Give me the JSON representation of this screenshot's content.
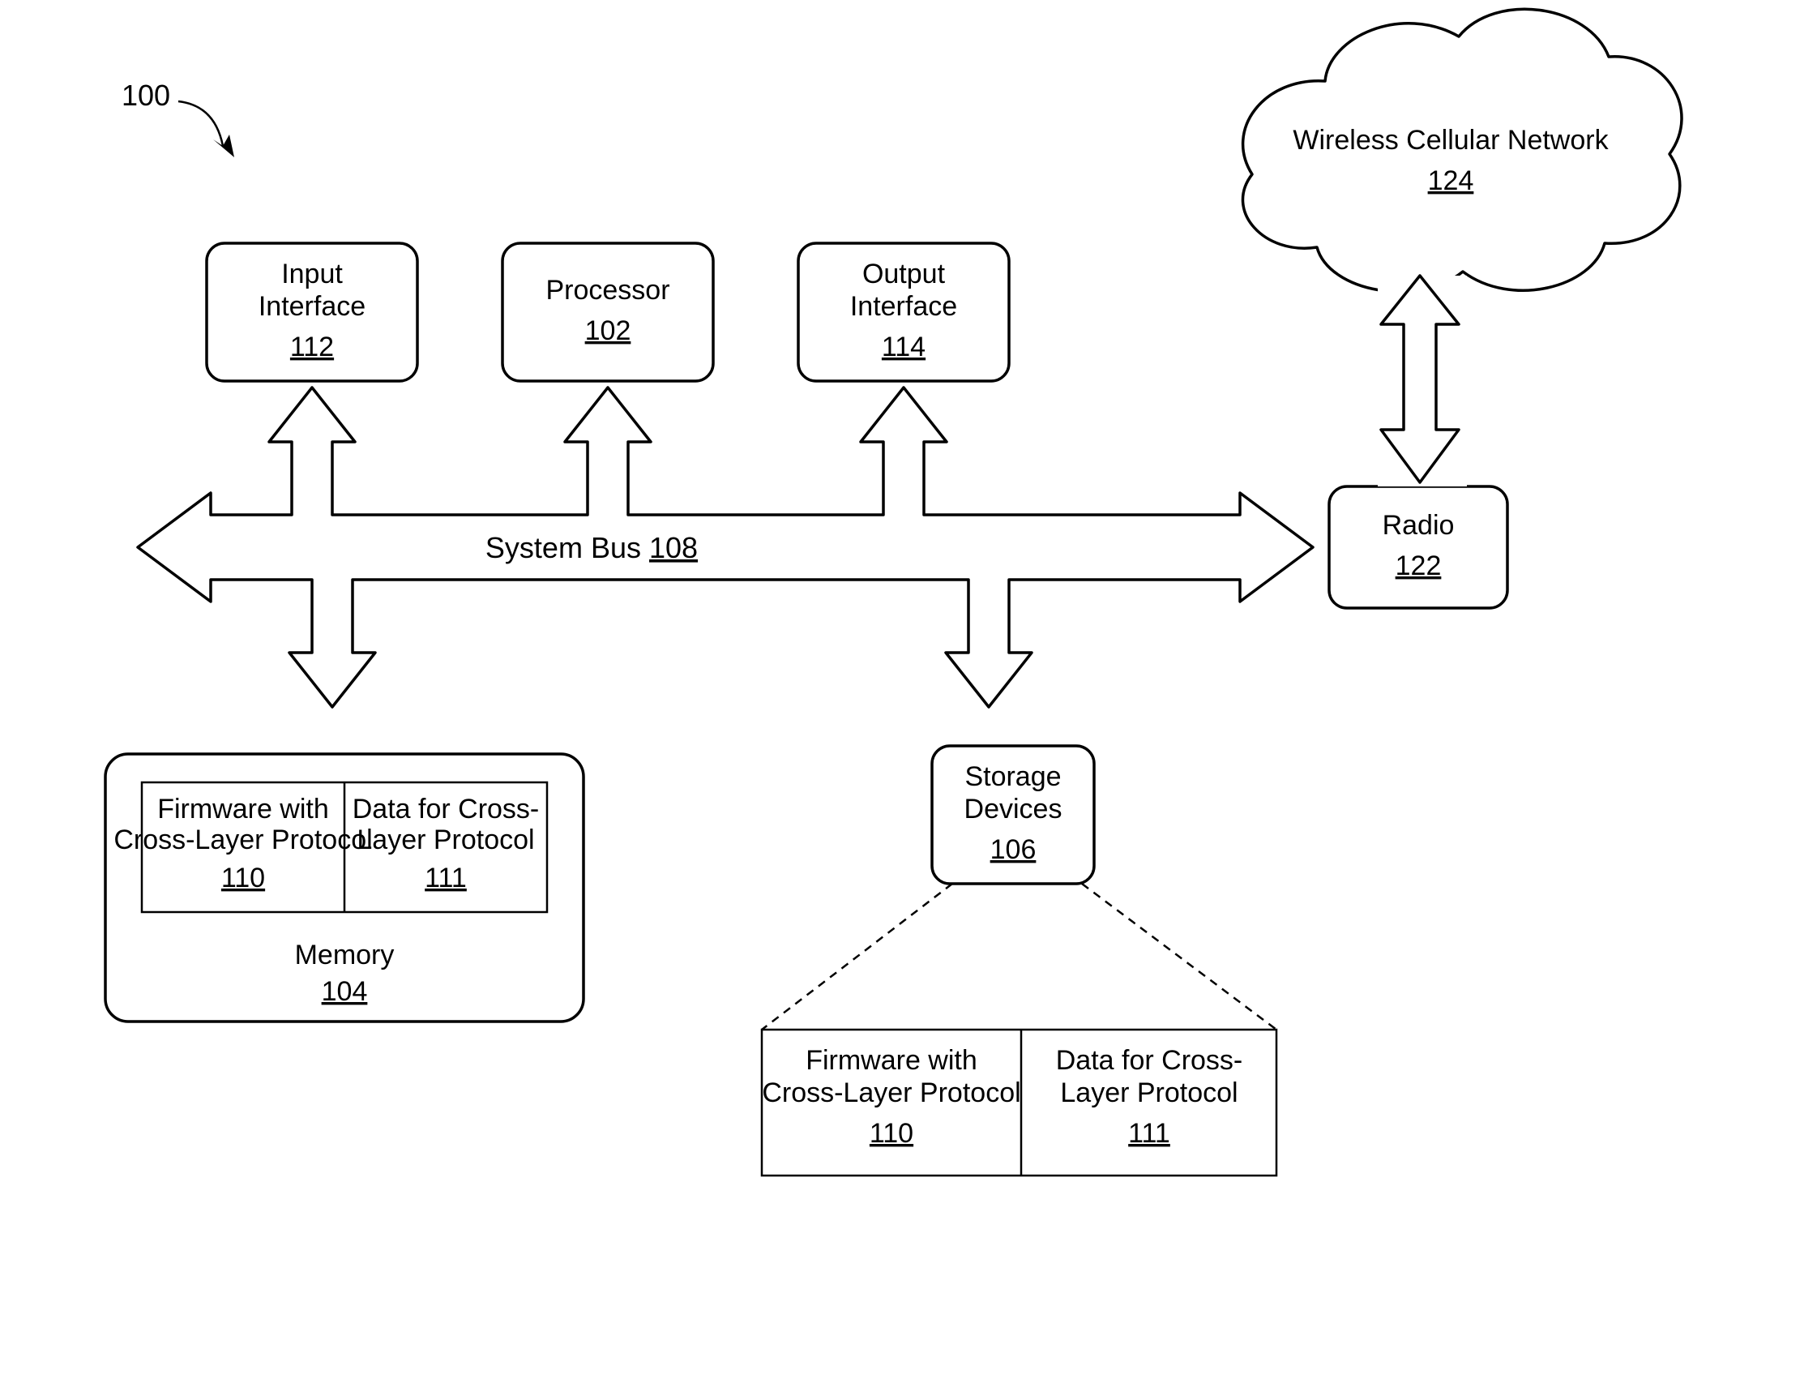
{
  "figure_ref": "100",
  "bus": {
    "label": "System Bus",
    "ref": "108"
  },
  "blocks": {
    "input": {
      "label1": "Input",
      "label2": "Interface",
      "ref": "112"
    },
    "proc": {
      "label1": "Processor",
      "ref": "102"
    },
    "output": {
      "label1": "Output",
      "label2": "Interface",
      "ref": "114"
    },
    "radio": {
      "label1": "Radio",
      "ref": "122"
    },
    "network": {
      "label1": "Wireless Cellular Network",
      "ref": "124"
    },
    "storage": {
      "label1": "Storage",
      "label2": "Devices",
      "ref": "106"
    },
    "memory": {
      "label1": "Memory",
      "ref": "104"
    },
    "fw": {
      "label1": "Firmware with",
      "label2": "Cross-Layer Protocol",
      "ref": "110"
    },
    "data": {
      "label1": "Data for Cross-",
      "label2": "Layer Protocol",
      "ref": "111"
    }
  }
}
